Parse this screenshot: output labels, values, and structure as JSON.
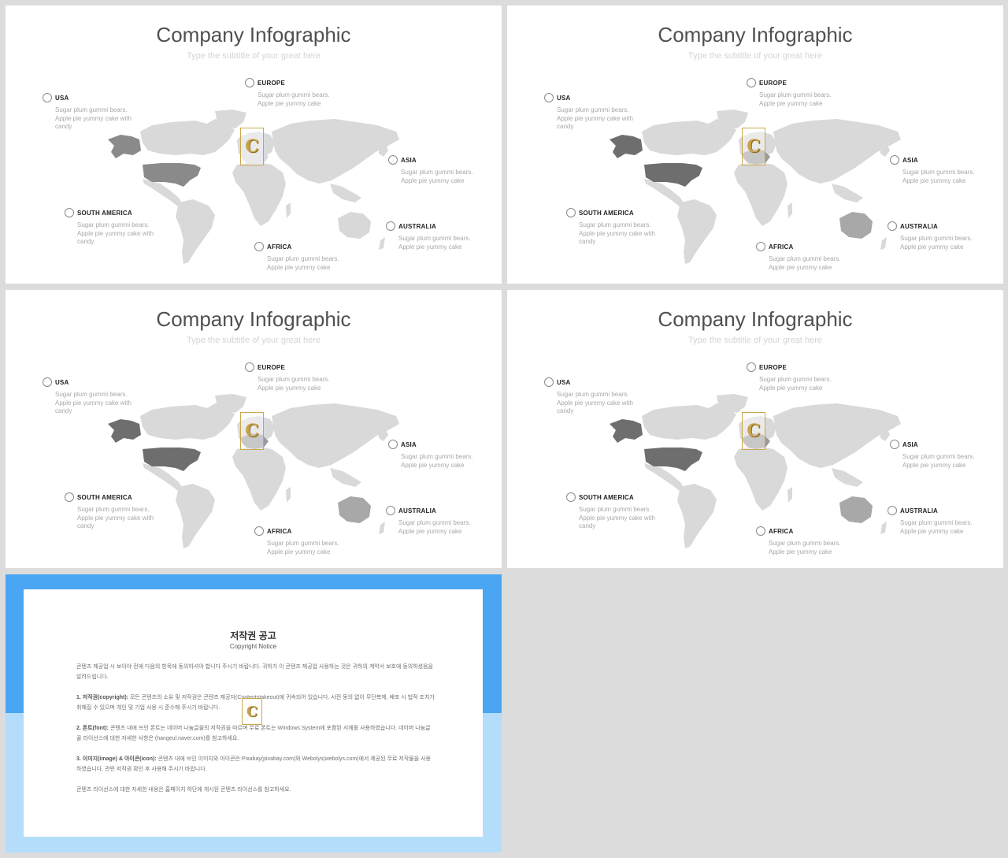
{
  "slides": [
    {
      "title": "Company Infographic",
      "subtitle": "Type the subtitle of your great here",
      "highlight": {
        "alaska": "#8a8a8a",
        "usa": "#8a8a8a",
        "europe": "#d8d8d8",
        "australia": "#d8d8d8"
      },
      "markers": [
        {
          "label": "USA",
          "desc": "Sugar plum gummi bears. Apple pie yummy cake with candy"
        },
        {
          "label": "EUROPE",
          "desc": "Sugar plum gummi bears. Apple pie yummy cake"
        },
        {
          "label": "ASIA",
          "desc": "Sugar plum gummi bears. Apple pie yummy cake"
        },
        {
          "label": "SOUTH AMERICA",
          "desc": "Sugar plum gummi bears. Apple pie yummy cake with candy"
        },
        {
          "label": "AUSTRALIA",
          "desc": "Sugar plum gummi bears. Apple pie yummy cake"
        },
        {
          "label": "AFRICA",
          "desc": "Sugar plum gummi bears. Apple pie yummy cake"
        }
      ]
    },
    {
      "title": "Company Infographic",
      "subtitle": "Type the subtitle of your great here",
      "highlight": {
        "alaska": "#6e6e6e",
        "usa": "#6e6e6e",
        "europe": "#9a9a9a",
        "australia": "#a8a8a8"
      },
      "markers": [
        {
          "label": "USA",
          "desc": "Sugar plum gummi bears. Apple pie yummy cake with candy"
        },
        {
          "label": "EUROPE",
          "desc": "Sugar plum gummi bears. Apple pie yummy cake"
        },
        {
          "label": "ASIA",
          "desc": "Sugar plum gummi bears. Apple pie yummy cake"
        },
        {
          "label": "SOUTH AMERICA",
          "desc": "Sugar plum gummi bears. Apple pie yummy cake with candy"
        },
        {
          "label": "AUSTRALIA",
          "desc": "Sugar plum gummi bears. Apple pie yummy cake"
        },
        {
          "label": "AFRICA",
          "desc": "Sugar plum gummi bears. Apple pie yummy cake"
        }
      ]
    },
    {
      "title": "Company Infographic",
      "subtitle": "Type the subtitle of your great here",
      "highlight": {
        "alaska": "#6e6e6e",
        "usa": "#6e6e6e",
        "europe": "#9a9a9a",
        "australia": "#a8a8a8"
      },
      "markers": [
        {
          "label": "USA",
          "desc": "Sugar plum gummi bears. Apple pie yummy cake with candy"
        },
        {
          "label": "EUROPE",
          "desc": "Sugar plum gummi bears. Apple pie yummy cake"
        },
        {
          "label": "ASIA",
          "desc": "Sugar plum gummi bears. Apple pie yummy cake"
        },
        {
          "label": "SOUTH AMERICA",
          "desc": "Sugar plum gummi bears. Apple pie yummy cake with candy"
        },
        {
          "label": "AUSTRALIA",
          "desc": "Sugar plum gummi bears. Apple pie yummy cake"
        },
        {
          "label": "AFRICA",
          "desc": "Sugar plum gummi bears. Apple pie yummy cake"
        }
      ]
    },
    {
      "title": "Company Infographic",
      "subtitle": "Type the subtitle of your great here",
      "highlight": {
        "alaska": "#6e6e6e",
        "usa": "#6e6e6e",
        "europe": "#9a9a9a",
        "australia": "#a8a8a8"
      },
      "markers": [
        {
          "label": "USA",
          "desc": "Sugar plum gummi bears. Apple pie yummy cake with candy"
        },
        {
          "label": "EUROPE",
          "desc": "Sugar plum gummi bears. Apple pie yummy cake"
        },
        {
          "label": "ASIA",
          "desc": "Sugar plum gummi bears. Apple pie yummy cake"
        },
        {
          "label": "SOUTH AMERICA",
          "desc": "Sugar plum gummi bears. Apple pie yummy cake with candy"
        },
        {
          "label": "AUSTRALIA",
          "desc": "Sugar plum gummi bears. Apple pie yummy cake"
        },
        {
          "label": "AFRICA",
          "desc": "Sugar plum gummi bears. Apple pie yummy cake"
        }
      ]
    }
  ],
  "logo_glyph": "C",
  "colors": {
    "land": "#d9d9d9",
    "page_bg": "#dcdcdc",
    "notice_top": "#4aa5f3",
    "notice_bottom": "#b4ddfb",
    "logo_gold": "#c8a24a"
  },
  "notice": {
    "title": "저작권 공고",
    "subtitle": "Copyright Notice",
    "paragraphs": [
      {
        "heading": "",
        "text": "콘텐츠 제공업 시 보아야 전에 다음의 항목에 동의하셔야 합니다 주시기 바랍니다. 귀하가 이 콘텐츠 제공업 사용하는 것은 귀하의 계약서 보호에 동의하셨음을 알려드립니다."
      },
      {
        "heading": "1. 저작권(copyright):",
        "text": "모든 콘텐츠의 소유 및 저작권은 콘텐츠 제공자(Contentstakeout)에 귀속되어 있습니다. 사전 동의 없이 무단복제, 배포 시 법적 조치가 취해질 수 있으며 개인 및 기업 사용 시 준수해 주시기 바랍니다."
      },
      {
        "heading": "2. 폰트(font):",
        "text": "콘텐츠 내에 쓰인 폰트는 네이버 나눔글꼴의 저작권을 따르며 무료 폰트는 Windows System에 포함된 서체를 사용하였습니다. 네이버 나눔글꼴 라이선스에 대한 자세한 사항은 (hangeul.naver.com)를 참고하세요."
      },
      {
        "heading": "3. 이미지(image) & 아이콘(icon):",
        "text": "콘텐츠 내에 쓰인 이미지와 아이콘은 Pixabay(pixabay.com)와 Webolys(webolys.com)에서 제공된 무료 저작물을 사용하였습니다. 관련 저작권 확인 후 사용해 주시기 바랍니다."
      },
      {
        "heading": "",
        "text": "콘텐츠 라이선스에 대한 자세한 내용은 홈페이지 하단에 게시된 콘텐츠 라이선스를 참고하세요."
      }
    ]
  }
}
